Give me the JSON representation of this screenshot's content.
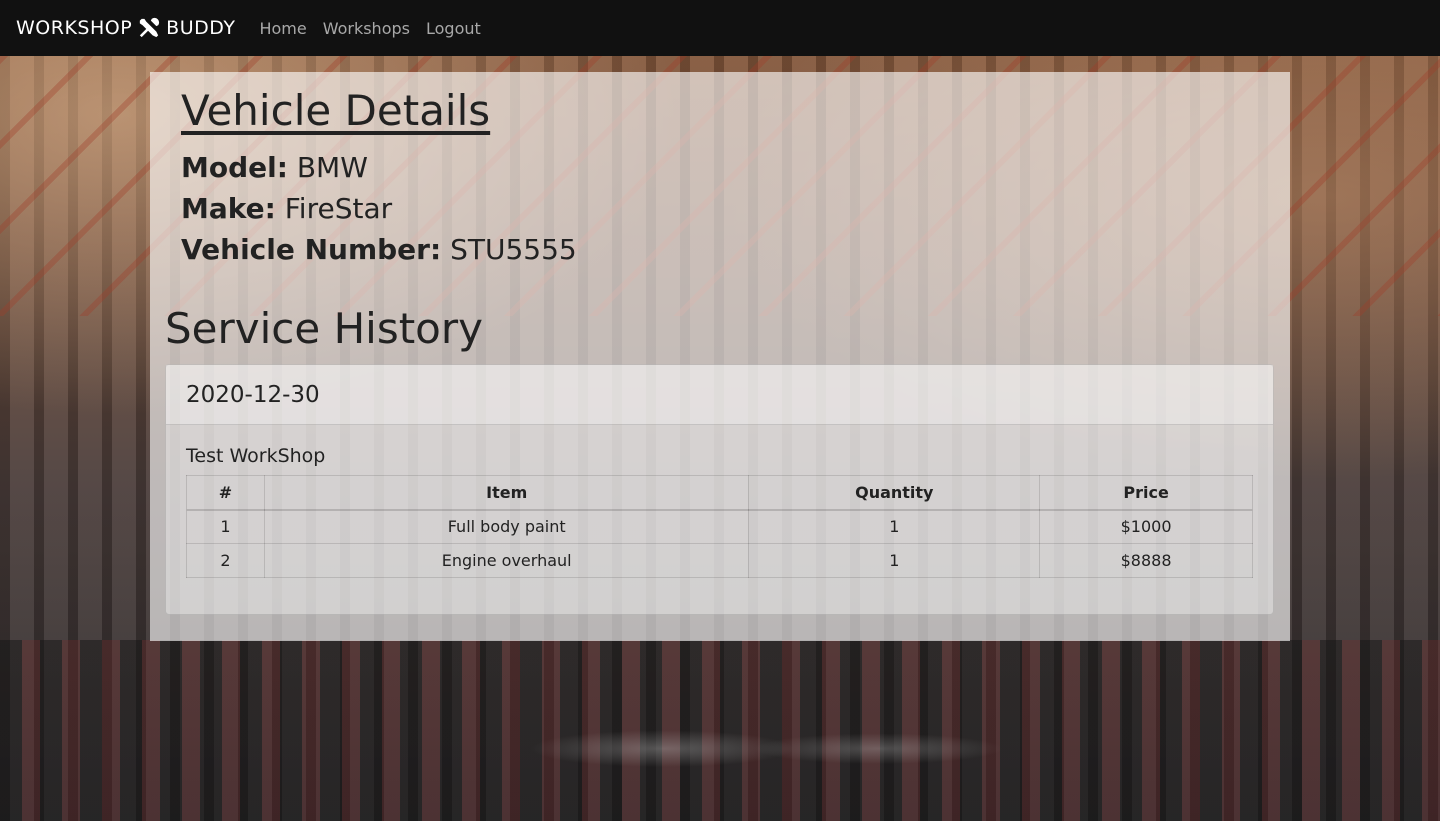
{
  "navbar": {
    "brand_left": "WORKSHOP",
    "brand_right": "BUDDY",
    "brand_icon": "wrench-screwdriver-icon",
    "links": [
      "Home",
      "Workshops",
      "Logout"
    ]
  },
  "vehicle": {
    "heading": "Vehicle Details",
    "fields": [
      {
        "label": "Model:",
        "value": "BMW"
      },
      {
        "label": "Make:",
        "value": "FireStar"
      },
      {
        "label": "Vehicle Number:",
        "value": "STU5555"
      }
    ]
  },
  "service_history": {
    "heading": "Service History",
    "entries": [
      {
        "date": "2020-12-30",
        "workshop": "Test WorkShop",
        "columns": [
          "#",
          "Item",
          "Quantity",
          "Price"
        ],
        "rows": [
          [
            "1",
            "Full body paint",
            "1",
            "$1000"
          ],
          [
            "2",
            "Engine overhaul",
            "1",
            "$8888"
          ]
        ]
      }
    ]
  },
  "colors": {
    "navbar_bg": "#111111",
    "brand_text": "#ffffff",
    "nav_link": "#a8a8a8",
    "card_bg": "rgba(255,255,255,0.62)"
  }
}
